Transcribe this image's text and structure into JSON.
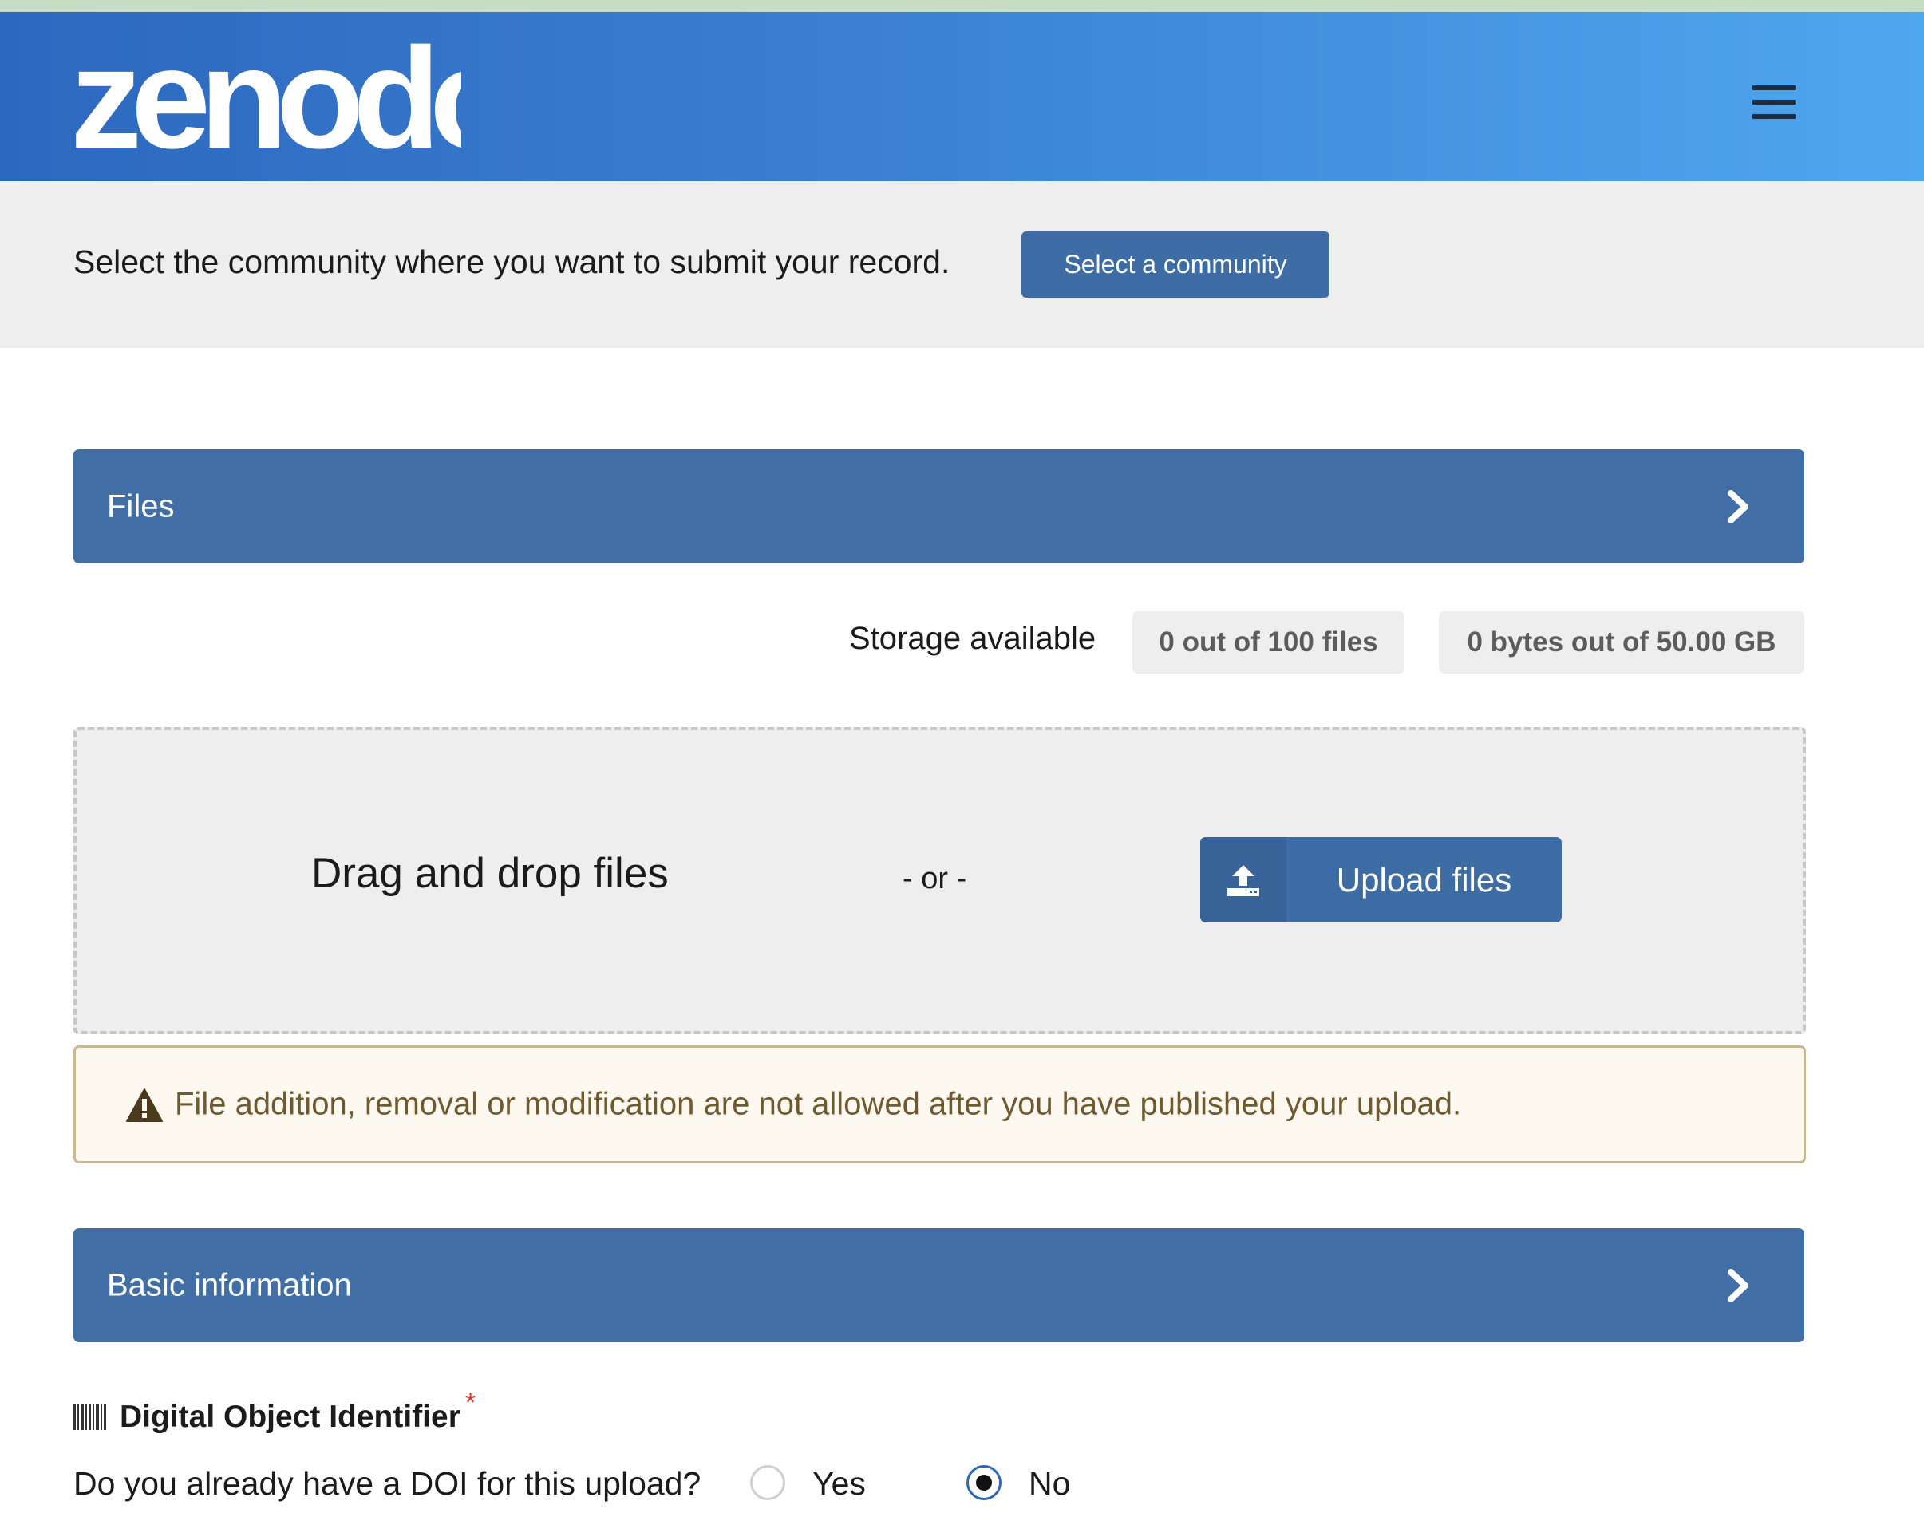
{
  "header": {
    "logo_text": "zenodo",
    "menu_icon": "hamburger-menu-icon",
    "colors": {
      "gradient_start": "#2c68bf",
      "gradient_end": "#4fa7ef"
    }
  },
  "community": {
    "prompt": "Select the community where you want to submit your record.",
    "button_label": "Select a community"
  },
  "files_section": {
    "title": "Files",
    "chevron_icon": "chevron-right-icon",
    "storage_label": "Storage available",
    "files_quota": "0 out of 100 files",
    "bytes_quota": "0 bytes out of 50.00 GB",
    "drag_text": "Drag and drop files",
    "or_text": "- or -",
    "upload_button_label": "Upload files",
    "upload_icon": "upload-icon",
    "warning_icon": "warning-triangle-icon",
    "warning_text": "File addition, removal or modification are not allowed after you have published your upload."
  },
  "basic_info_section": {
    "title": "Basic information",
    "chevron_icon": "chevron-right-icon",
    "doi": {
      "icon": "barcode-icon",
      "heading": "Digital Object Identifier",
      "required_marker": "*",
      "question": "Do you already have a DOI for this upload?",
      "options": [
        {
          "label": "Yes",
          "selected": false
        },
        {
          "label": "No",
          "selected": true
        }
      ]
    }
  },
  "colors": {
    "primary": "#416fa5",
    "warning_text": "#6f5a2f",
    "warning_border": "#cab88e"
  }
}
